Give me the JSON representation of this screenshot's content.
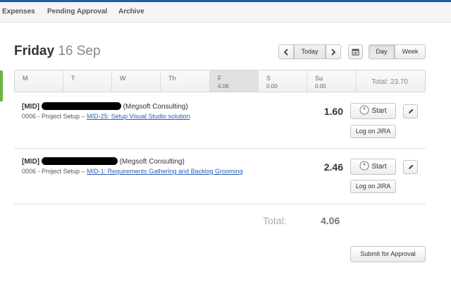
{
  "nav": {
    "items": [
      {
        "label": "Expenses"
      },
      {
        "label": "Pending Approval"
      },
      {
        "label": "Archive"
      }
    ]
  },
  "header": {
    "day_name": "Friday",
    "day_date": "16 Sep",
    "prev_icon": "chevron-left-icon",
    "today_label": "Today",
    "next_icon": "chevron-right-icon",
    "calendar_icon": "calendar-icon",
    "view_day_label": "Day",
    "view_week_label": "Week",
    "selected_view": "Day"
  },
  "week": {
    "days": [
      {
        "label": "M",
        "value": ""
      },
      {
        "label": "T",
        "value": ""
      },
      {
        "label": "W",
        "value": ""
      },
      {
        "label": "Th",
        "value": ""
      },
      {
        "label": "F",
        "value": "4.06"
      },
      {
        "label": "S",
        "value": "0.00"
      },
      {
        "label": "Su",
        "value": "0.00"
      }
    ],
    "selected_day": "F",
    "total": "Total: 23.70"
  },
  "entries": [
    {
      "code": "[MID]",
      "client": "(Megsoft Consulting)",
      "task": "0006 - Project Setup  –",
      "link": "MID-25: Setup Visual Studio solution",
      "hours": "1.60",
      "start_label": "Start",
      "jira_label": "Log on JIRA",
      "timer_icon": "stopwatch-icon",
      "edit_icon": "pencil-icon"
    },
    {
      "code": "[MID]",
      "client": "(Megsoft Consulting)",
      "task": "0006 - Project Setup  –",
      "link": "MID-1: Requirements Gathering and Backlog Grooming",
      "hours": "2.46",
      "start_label": "Start",
      "jira_label": "Log on JIRA",
      "timer_icon": "stopwatch-icon",
      "edit_icon": "pencil-icon"
    }
  ],
  "footer": {
    "total_label": "Total:",
    "total_value": "4.06",
    "submit_label": "Submit for Approval"
  },
  "colors": {
    "top_accent": "#1f5fa8",
    "active_indicator": "#6cb33f",
    "link": "#2a5db0"
  }
}
